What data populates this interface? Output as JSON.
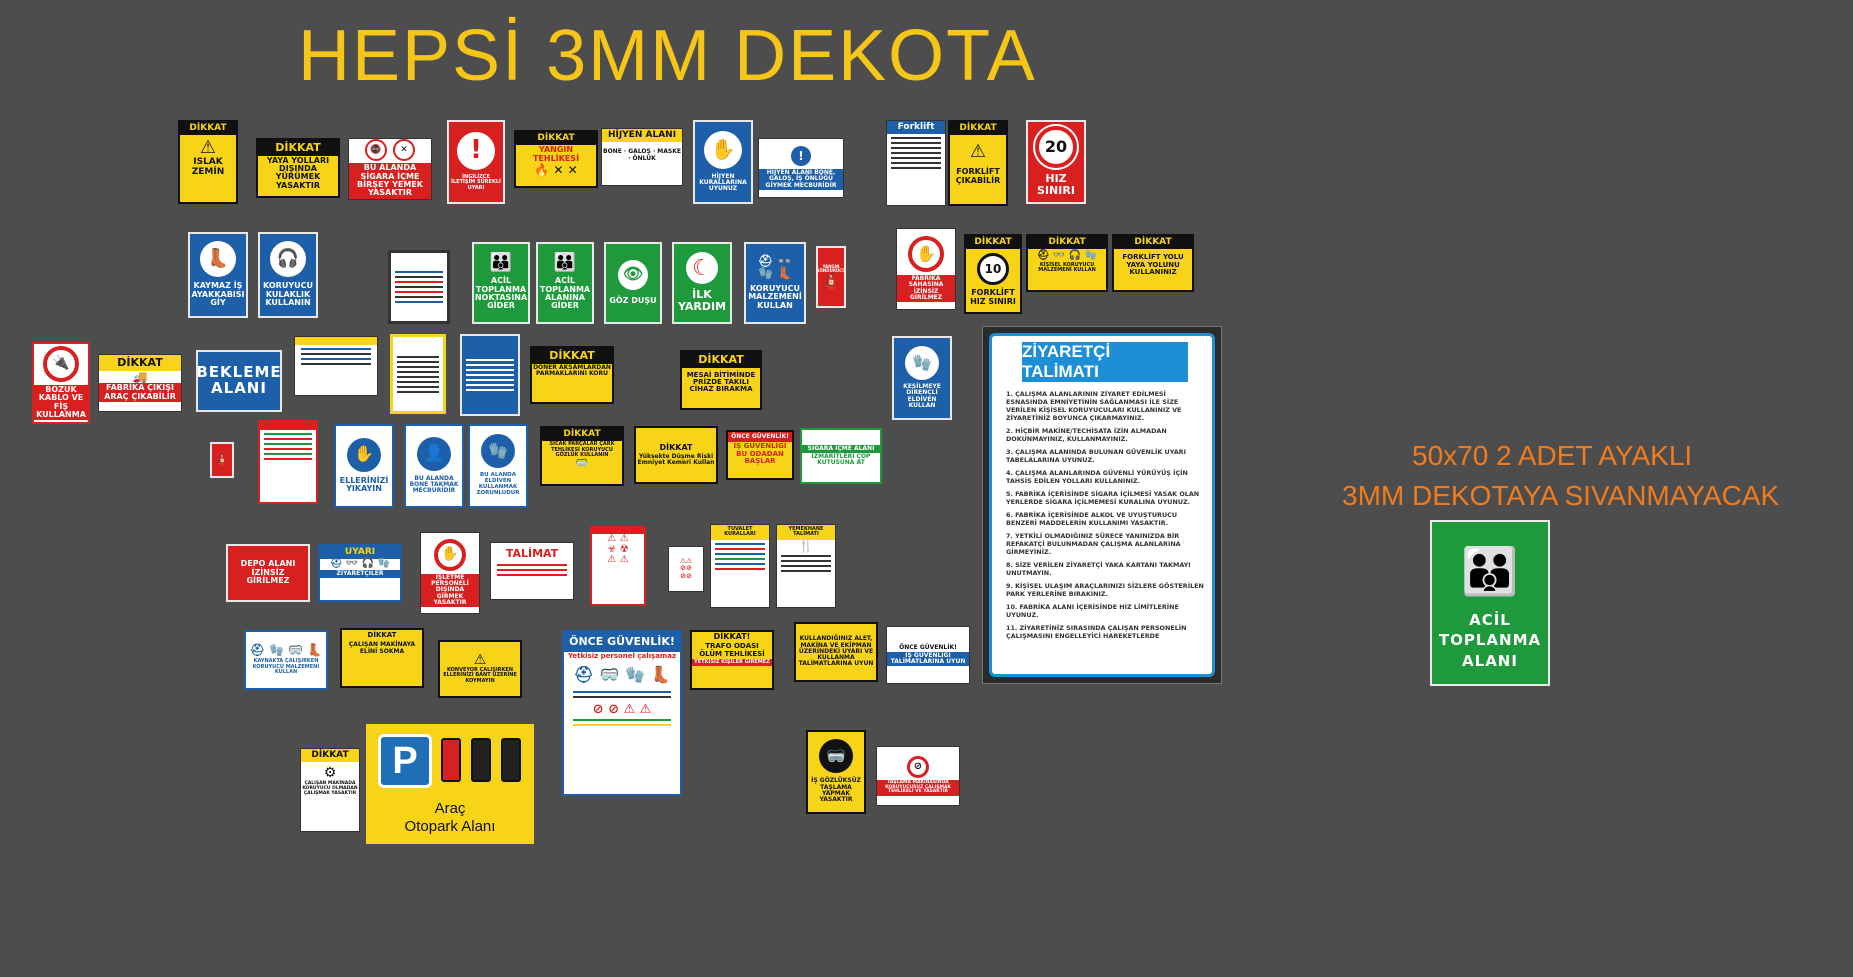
{
  "title": "HEPSİ 3MM DEKOTA",
  "note": {
    "line1": "50x70  2 ADET AYAKLI",
    "line2": "3MM DEKOTAYA SIVANMAYACAK"
  },
  "colors": {
    "background": "#4d4d4d",
    "title": "#f5c518",
    "note": "#f07c1e",
    "safety_yellow": "#f7d417",
    "safety_blue": "#1d5fa8",
    "safety_green": "#1e9a3c",
    "safety_red": "#d82020",
    "visitor_blue": "#1e8fd6"
  },
  "signs": {
    "s1": {
      "head": "DİKKAT",
      "text": "ISLAK ZEMİN",
      "icon": "slippery-floor-icon"
    },
    "s2": {
      "head": "DİKKAT",
      "text": "YAYA YOLLARI DIŞINDA YÜRÜMEK YASAKTIR"
    },
    "s3": {
      "text": "BU ALANDA SİGARA İÇME BİRŞEY YEMEK YASAKTIR",
      "icon": "no-smoking-icon"
    },
    "s4": {
      "text": "İNGİLİZCE İLETİŞİM SÜREKLİ UYARI",
      "icon": "exclamation-icon"
    },
    "s5": {
      "head": "DİKKAT",
      "text": "YANGIN TEHLİKESİ"
    },
    "s6": {
      "head": "HİJYEN ALANI",
      "text": "BONE · GALOŞ · MASKE · ÖNLÜK"
    },
    "s7": {
      "text": "HİJYEN KURALLARINA UYUNUZ",
      "icon": "hand-wash-icon"
    },
    "s8": {
      "text": "HİJYEN ALANI BONE, GALOŞ, İŞ ÖNLÜĞÜ GİYMEK MECBURİDİR",
      "icon": "info-icon"
    },
    "s9": {
      "head": "Forklift",
      "text": "FORKLİFT KULLANMA TALİMATI"
    },
    "s10": {
      "head": "DİKKAT",
      "text": "FORKLİFT ÇIKABİLİR"
    },
    "s11": {
      "number": "20",
      "text": "HIZ SINIRI"
    },
    "s12": {
      "text": "KAYMAZ İŞ AYAKKABISI GİY",
      "icon": "boot-icon"
    },
    "s13": {
      "text": "KORUYUCU KULAKLIK KULLANIN",
      "icon": "ear-protection-icon"
    },
    "s15": {
      "text": "ACİL TOPLANMA NOKTASINA GİDER"
    },
    "s16": {
      "text": "ACİL TOPLANMA ALANINA GİDER"
    },
    "s17": {
      "text": "GÖZ DUŞU",
      "icon": "eye-wash-icon"
    },
    "s18": {
      "text": "İLK YARDIM",
      "icon": "crescent-icon"
    },
    "s19": {
      "text": "KORUYUCU MALZEMENİ KULLAN"
    },
    "s20": {
      "text": "YANGIN SÖNDÜRÜCÜ",
      "icon": "extinguisher-icon"
    },
    "s21": {
      "text": "FABRİKA SAHASINA İZİNSİZ GİRİLMEZ",
      "icon": "no-entry-hand-icon"
    },
    "s22": {
      "head": "DİKKAT",
      "number": "10",
      "text": "FORKLİFT HIZ SINIRI"
    },
    "s23": {
      "head": "DİKKAT",
      "text": "KİŞİSEL KORUYUCU MALZEMENİ KULLAN"
    },
    "s24": {
      "head": "DİKKAT",
      "text": "FORKLİFT YOLU YAYA YOLUNU KULLANINIZ"
    },
    "s25": {
      "text": "BOZUK KABLO VE FİŞ KULLANMA",
      "icon": "no-plug-icon"
    },
    "s26": {
      "head": "DİKKAT",
      "text": "FABRİKA ÇIKIŞI ARAÇ ÇIKABİLİR"
    },
    "s27": {
      "text": "BEKLEME ALANI"
    },
    "s30": {
      "head": "DİKKAT",
      "text": "DÖNER AKSAMLARDAN PARMAKLARINI KORU"
    },
    "s31": {
      "head": "DİKKAT",
      "text": "MESAİ BİTİMİNDE PRİZDE TAKILI CİHAZ BIRAKMA"
    },
    "s32": {
      "text": "KESİLMEYE DİRENÇLİ ELDİVEN KULLAN",
      "icon": "glove-icon"
    },
    "s34": {
      "text": "ELLERİNİZİ YIKAYIN",
      "icon": "hand-wash-icon"
    },
    "s35": {
      "text": "BU ALANDA BONE TAKMAK MECBURİDİR",
      "icon": "hair-cover-icon"
    },
    "s36": {
      "text": "BU ALANDA ELDİVEN KULLANMAK ZORUNLUDUR",
      "icon": "glove-icon"
    },
    "s37": {
      "head": "DİKKAT",
      "text": "SICAK PARÇALAR ÇARK TEHLİKESİ KORUYUCU GÖZLÜK KULLANIN"
    },
    "s38": {
      "head": "DİKKAT",
      "text": "Yüksekte Düşme Riski Emniyet Kemeri Kullan"
    },
    "s39": {
      "head": "ÖNCE GÜVENLİK!",
      "text": "İŞ GÜVENLİĞİ BU ODADAN BAŞLAR"
    },
    "s40": {
      "head": "SIGARA İÇME ALANI",
      "text": "İZMARİTLERİ ÇÖP KUTUSUNA AT"
    },
    "s41": {
      "text": "DEPO ALANI İZİNSİZ GİRİLMEZ"
    },
    "s42": {
      "head": "UYARI",
      "text": "ZİYARETÇİLER"
    },
    "s43": {
      "text": "İŞLETME PERSONELİ DIŞINDA GİRMEK YASAKTIR",
      "icon": "no-entry-hand-icon"
    },
    "s44": {
      "head": "TALİMAT"
    },
    "s47": {
      "head": "TUVALET KURALLARI"
    },
    "s48": {
      "head": "YEMEKHANE TALİMATI"
    },
    "s49": {
      "text": "KAYNAKTA ÇALIŞIRKEN KORUYUCU MALZEMENİ KULLAN"
    },
    "s50": {
      "head": "DİKKAT",
      "text": "ÇALIŞAN MAKİNAYA ELİNİ SOKMA"
    },
    "s51": {
      "text": "KONVEYOR ÇALIŞIRKEN ELLERİNİZİ BANT ÜZERİNE KOYMAYIN"
    },
    "s52": {
      "head": "ÖNCE GÜVENLİK!",
      "text": "Yetkisiz personel çalışamaz"
    },
    "s53": {
      "head": "DİKKAT!",
      "text": "TRAFO ODASI ÖLÜM TEHLİKESİ",
      "sub": "YETKİSİZ KİŞİLER GİREMEZ"
    },
    "s54": {
      "text": "KULLANDIĞINIZ ALET, MAKİNA VE EKİPMAN ÜZERİNDEKİ UYARI VE KULLANMA TALİMATLARINA UYUN"
    },
    "s55": {
      "head": "ÖNCE GÜVENLİK!",
      "text": "İŞ GÜVENLİĞİ TALİMATLARINA UYUN"
    },
    "s56": {
      "head": "DİKKAT",
      "text": "ÇALIŞAN MAKİNADA KORUYUCU OLMADAN ÇALIŞMAK YASAKTIR"
    },
    "s57": {
      "text": "İŞ GÖZLÜKSÜZ TAŞLAMA YAPMAK YASAKTIR",
      "icon": "goggles-icon"
    },
    "s58": {
      "text": "TAŞLAMA MAKİNASINDA KORUYUCUSUZ ÇALIŞMAK TEHLİKELİ VE YASAKTIR"
    }
  },
  "visitor": {
    "title": "ZİYARETÇİ TALİMATI",
    "items": [
      "1. ÇALIŞMA ALANLARININ ZİYARET EDİLMESİ ESNASINDA EMNİYETİNİN SAĞLANMASI İLE SİZE VERİLEN KİŞİSEL KORUYUCULARI KULLANINIZ VE ZİYARETİNİZ BOYUNCA ÇIKARMAYINIZ.",
      "2. HİÇBİR MAKİNE/TECHİSATA İZİN ALMADAN DOKUNMAYINIZ, KULLANMAYINIZ.",
      "3. ÇALIŞMA ALANINDA BULUNAN GÜVENLİK UYARI TABELALARINA UYUNUZ.",
      "4. ÇALIŞMA ALANLARINDA GÜVENLİ YÜRÜYÜŞ İÇİN TAHSİS EDİLEN YOLLARI KULLANINIZ.",
      "5. FABRİKA İÇERİSİNDE SİGARA İÇİLMESİ YASAK OLAN YERLERDE SİGARA İÇİLMEMESİ KURALINA UYUNUZ.",
      "6. FABRİKA İÇERİSİNDE ALKOL VE UYUŞTURUCU BENZERİ MADDELERİN KULLANIMI YASAKTIR.",
      "7. YETKİLİ OLMADIĞINIZ SÜRECE YANINIZDA BİR REFAKATÇİ BULUNMADAN ÇALIŞMA ALANLARINA GİRMEYİNİZ.",
      "8. SİZE VERİLEN ZİYARETÇİ YAKA KARTANI TAKMAYI UNUTMAYIN.",
      "9. KİŞİSEL ULAŞIM ARAÇLARINIZI SİZLERE GÖSTERİLEN PARK YERLERİNE BIRAKINIZ.",
      "10. FABRİKA ALANI İÇERİSİNDE HIZ LİMİTLERİNE UYUNUZ.",
      "11. ZİYARETİNİZ SIRASINDA ÇALIŞAN PERSONELİN ÇALIŞMASINI ENGELLEYİCİ HAREKETLERDE"
    ]
  },
  "assembly": {
    "line1": "ACİL",
    "line2": "TOPLANMA",
    "line3": "ALANI",
    "icon": "assembly-point-icon"
  },
  "parking": {
    "letter": "P",
    "line1": "Araç",
    "line2": "Otopark Alanı",
    "icon": "parking-icon"
  }
}
